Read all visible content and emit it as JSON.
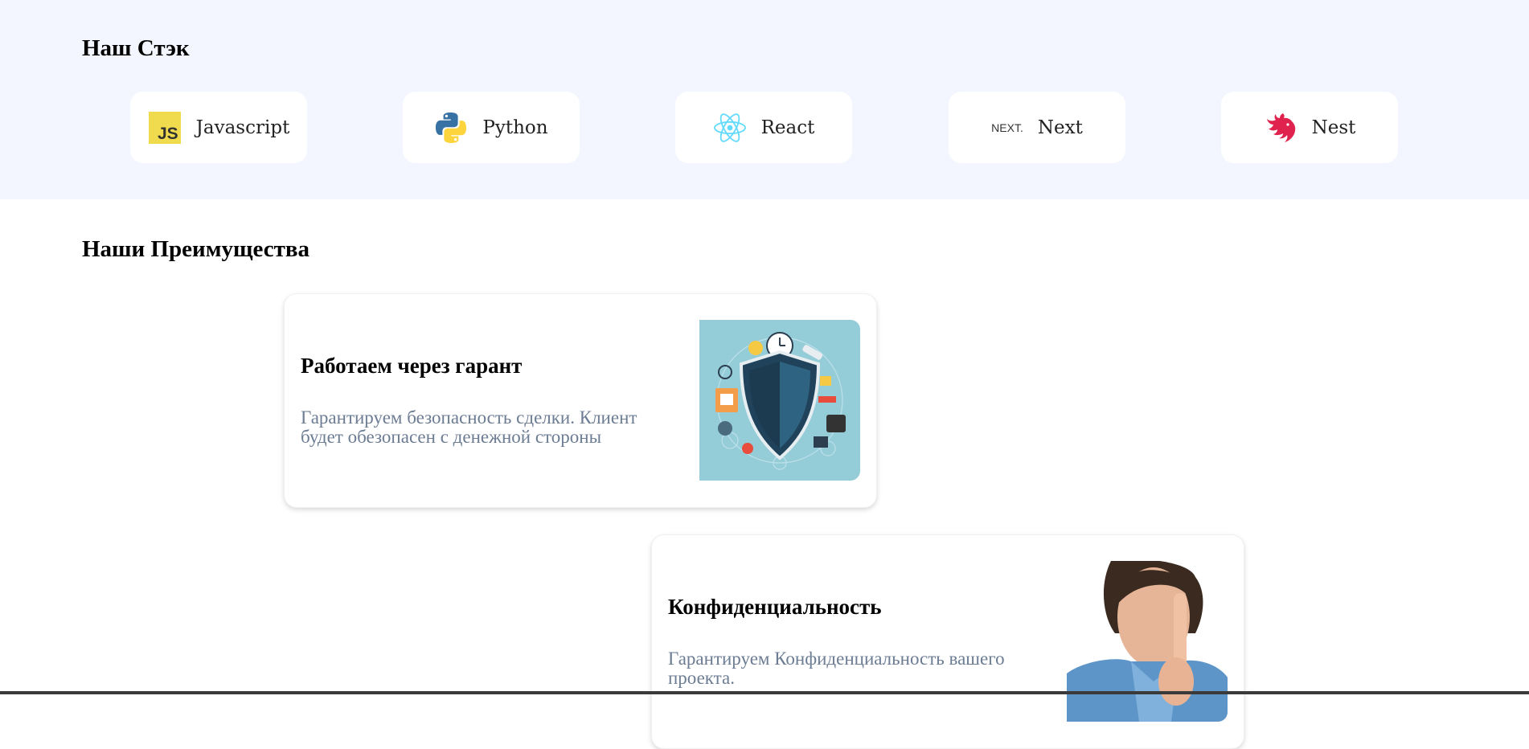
{
  "stack": {
    "title": "Наш Стэк",
    "items": [
      {
        "label": "Javascript",
        "icon": "javascript-logo-icon",
        "icon_text": "JS"
      },
      {
        "label": "Python",
        "icon": "python-logo-icon"
      },
      {
        "label": "React",
        "icon": "react-logo-icon"
      },
      {
        "label": "Next",
        "icon": "nextjs-logo-icon",
        "icon_text": "NEXT."
      },
      {
        "label": "Nest",
        "icon": "nestjs-logo-icon"
      }
    ]
  },
  "advantages": {
    "title": "Наши Преимущества",
    "items": [
      {
        "title": "Работаем через гарант",
        "text": "Гарантируем безопасность сделки. Клиент будет обезопасен с денежной стороны",
        "image": "security-shield-illustration"
      },
      {
        "title": "Конфиденциальность",
        "text": "Гарантируем Конфиденциальность вашего проекта.",
        "image": "man-finger-on-lips-photo"
      }
    ]
  },
  "colors": {
    "stack_background": "#f3f6fe",
    "advantage_text": "#6b7c93",
    "javascript_yellow": "#f0db4f",
    "react_blue": "#61dafb",
    "nest_red": "#e0234e",
    "shield_bg": "#94ccd8"
  }
}
